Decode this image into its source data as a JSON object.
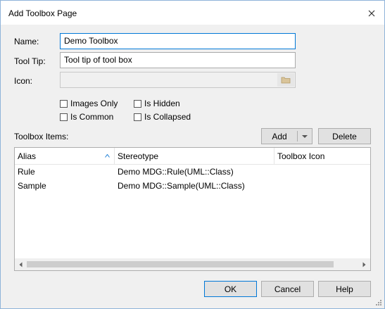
{
  "window": {
    "title": "Add Toolbox Page"
  },
  "form": {
    "name_label": "Name:",
    "name_value": "Demo Toolbox",
    "tooltip_label": "Tool Tip:",
    "tooltip_value": "Tool tip of tool box",
    "icon_label": "Icon:",
    "icon_value": ""
  },
  "options": {
    "images_only": "Images Only",
    "is_hidden": "Is Hidden",
    "is_common": "Is Common",
    "is_collapsed": "Is Collapsed"
  },
  "toolbox_items": {
    "label": "Toolbox Items:",
    "add_label": "Add",
    "delete_label": "Delete",
    "columns": [
      "Alias",
      "Stereotype",
      "Toolbox Icon"
    ],
    "rows": [
      {
        "alias": "Rule",
        "stereotype": "Demo MDG::Rule(UML::Class)",
        "icon": ""
      },
      {
        "alias": "Sample",
        "stereotype": "Demo MDG::Sample(UML::Class)",
        "icon": ""
      }
    ]
  },
  "footer": {
    "ok_label": "OK",
    "cancel_label": "Cancel",
    "help_label": "Help"
  },
  "colors": {
    "focus_border": "#0078d7",
    "dialog_bg": "#f0f0f0"
  }
}
